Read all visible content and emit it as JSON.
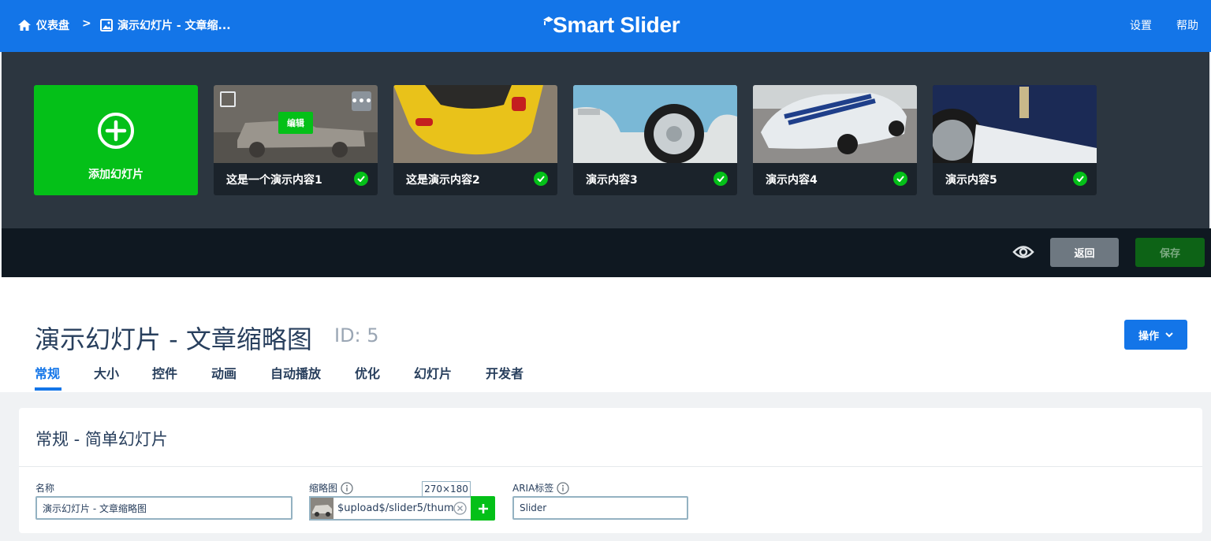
{
  "topbar": {
    "breadcrumb": [
      {
        "label": "仪表盘",
        "icon": "home-icon"
      },
      {
        "label": "演示幻灯片 - 文章缩...",
        "icon": "image-icon"
      }
    ],
    "separator": ">",
    "logo_text": "Smart Slider",
    "settings_label": "设置",
    "help_label": "帮助"
  },
  "slides": {
    "add_label": "添加幻灯片",
    "edit_label": "编辑",
    "more_label": "•••",
    "items": [
      {
        "title": "这是一个演示内容1",
        "published": true
      },
      {
        "title": "这是演示内容2",
        "published": true
      },
      {
        "title": "演示内容3",
        "published": true
      },
      {
        "title": "演示内容4",
        "published": true
      },
      {
        "title": "演示内容5",
        "published": true
      }
    ]
  },
  "actions": {
    "preview_icon": "eye-icon",
    "back_label": "返回",
    "save_label": "保存"
  },
  "header": {
    "title": "演示幻灯片 - 文章缩略图",
    "id_label": "ID: 5",
    "ops_label": "操作",
    "tabs": [
      {
        "label": "常规",
        "active": true
      },
      {
        "label": "大小"
      },
      {
        "label": "控件"
      },
      {
        "label": "动画"
      },
      {
        "label": "自动播放"
      },
      {
        "label": "优化"
      },
      {
        "label": "幻灯片"
      },
      {
        "label": "开发者"
      }
    ]
  },
  "panel": {
    "title": "常规 - 简单幻灯片",
    "name_label": "名称",
    "name_value": "演示幻灯片 - 文章缩略图",
    "thumb_label": "缩略图",
    "thumb_value": "$upload$/slider5/thum",
    "thumb_size": "270×180",
    "aria_label": "ARIA标签",
    "aria_value": "Slider"
  },
  "colors": {
    "brand_blue": "#1375e8",
    "success_green": "#04c018",
    "dark_bg": "#2c3640",
    "action_bar": "#0f1821"
  }
}
